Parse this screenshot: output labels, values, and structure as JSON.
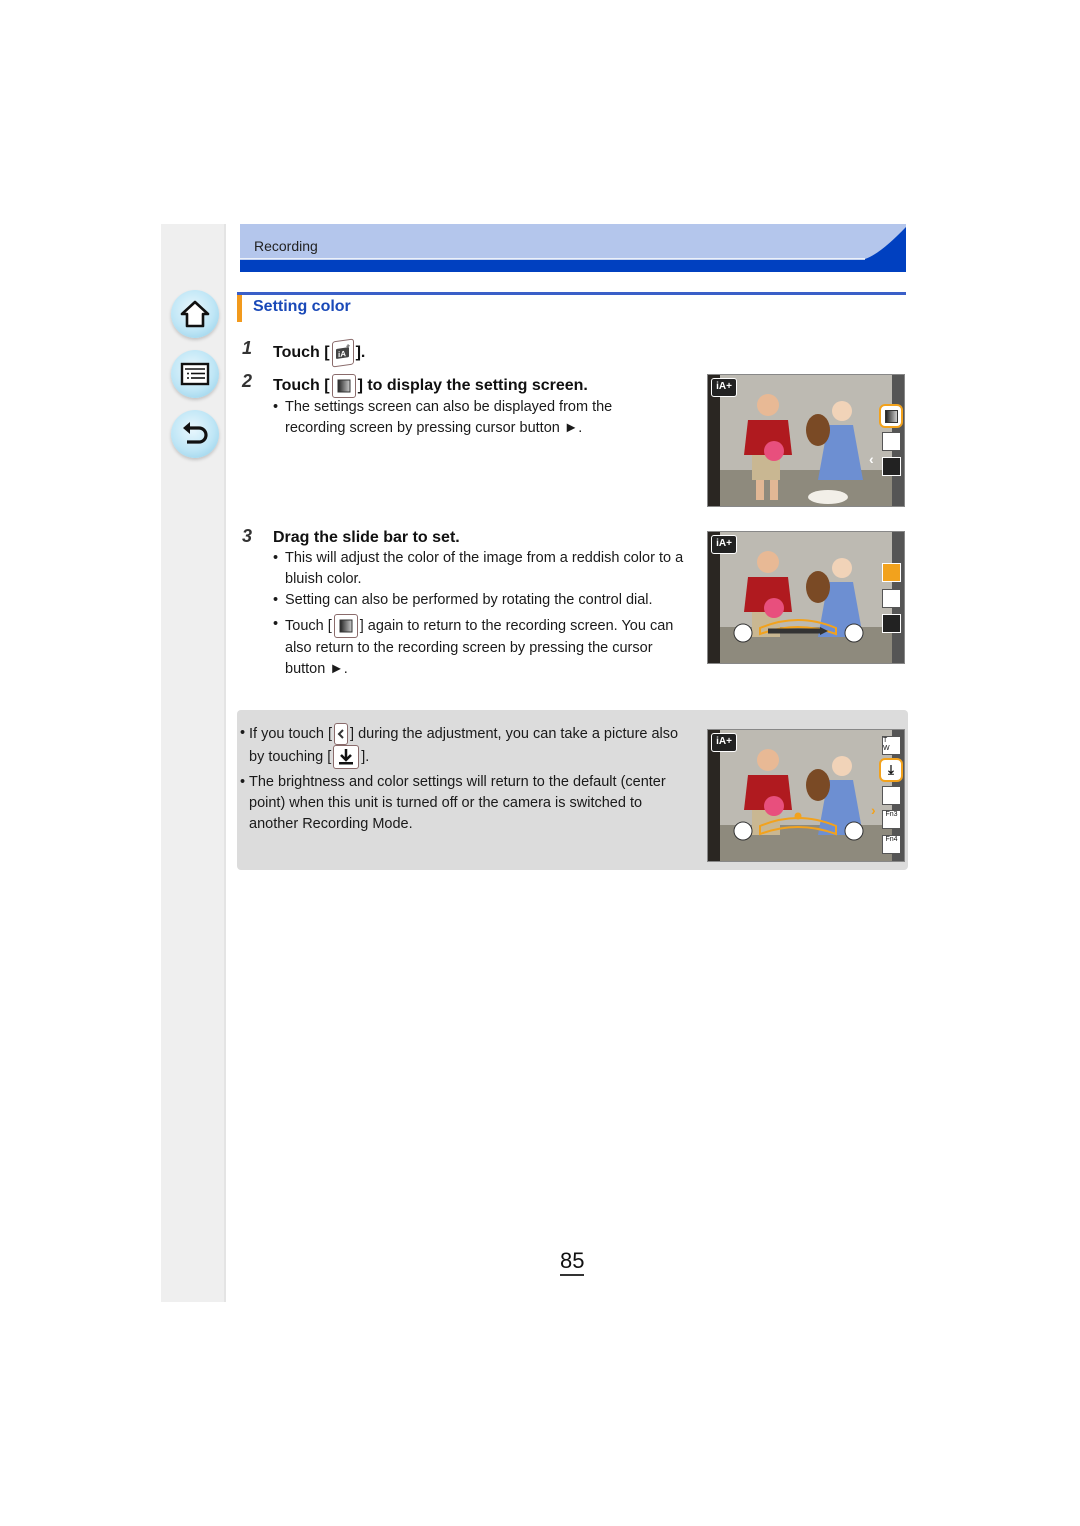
{
  "header": {
    "section_label": "Recording"
  },
  "nav": {
    "home_label": "Home",
    "contents_label": "Contents",
    "back_label": "Back"
  },
  "section": {
    "title": "Setting color"
  },
  "steps": [
    {
      "number": "1",
      "title_pre": "Touch [",
      "title_post": "].",
      "icon": "intelligent-auto-plus-icon"
    },
    {
      "number": "2",
      "title_pre": "Touch [",
      "title_post": "] to display the setting screen.",
      "icon": "color-setting-icon",
      "bullets": [
        "The settings screen can also be displayed from the recording screen by pressing cursor button ►."
      ]
    },
    {
      "number": "3",
      "title": "Drag the slide bar to set.",
      "bullets": [
        "This will adjust the color of the image from a reddish color to a bluish color.",
        "Setting can also be performed by rotating the control dial."
      ],
      "bullet3_pre": "Touch [",
      "bullet3_post": "] again to return to the recording screen. You can also return to the recording screen by pressing the cursor button ►."
    }
  ],
  "note": {
    "bullet1_pre": "If you touch [",
    "bullet1_mid": "] during the adjustment, you can take a picture also by touching [",
    "bullet1_post": "].",
    "bullet2": "The brightness and color settings will return to the default (center point) when this unit is turned off or the camera is switched to another Recording Mode."
  },
  "screens": {
    "mode_badge": "iA+",
    "fn3_label": "Fn3",
    "fn4_label": "Fn4",
    "zoom_t": "T",
    "zoom_w": "W",
    "slider_position": 0.5
  },
  "colors": {
    "banner_light": "#b4c6ec",
    "banner_dark": "#0040c0",
    "section_title": "#1a49b8",
    "accent_orange": "#f29a1d",
    "note_bg": "#dcdcdc"
  },
  "footer": {
    "page_number": "85"
  }
}
